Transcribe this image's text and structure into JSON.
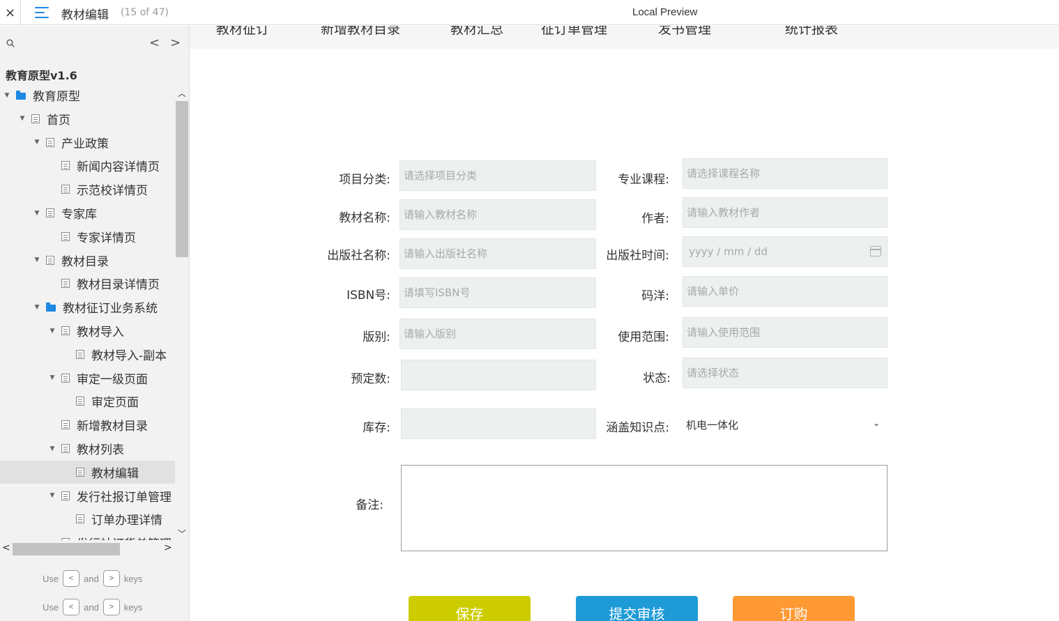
{
  "topbar": {
    "close_label": "×",
    "doc_title": "教材编辑",
    "page_count": "(15 of 47)",
    "preview_title": "Local Preview"
  },
  "sidebar": {
    "prev_label": "<",
    "next_label": ">",
    "project_title": "教育原型v1.6",
    "tree": [
      {
        "label": "教育原型",
        "level": 0,
        "icon": "folder-icon",
        "expanded": true
      },
      {
        "label": "首页",
        "level": 1,
        "icon": "page-icon",
        "expanded": true
      },
      {
        "label": "产业政策",
        "level": 2,
        "icon": "page-icon",
        "expanded": true
      },
      {
        "label": "新闻内容详情页",
        "level": 3,
        "icon": "page-icon",
        "expanded": false
      },
      {
        "label": "示范校详情页",
        "level": 3,
        "icon": "page-icon",
        "expanded": false
      },
      {
        "label": "专家库",
        "level": 2,
        "icon": "page-icon",
        "expanded": true
      },
      {
        "label": "专家详情页",
        "level": 3,
        "icon": "page-icon",
        "expanded": false
      },
      {
        "label": "教材目录",
        "level": 2,
        "icon": "page-icon",
        "expanded": true
      },
      {
        "label": "教材目录详情页",
        "level": 3,
        "icon": "page-icon",
        "expanded": false
      },
      {
        "label": "教材征订业务系统",
        "level": 2,
        "icon": "folder-icon",
        "expanded": true
      },
      {
        "label": "教材导入",
        "level": 3,
        "icon": "page-icon",
        "expanded": true
      },
      {
        "label": "教材导入-副本",
        "level": 4,
        "icon": "page-icon",
        "expanded": false
      },
      {
        "label": "审定一级页面",
        "level": 3,
        "icon": "page-icon",
        "expanded": true
      },
      {
        "label": "审定页面",
        "level": 4,
        "icon": "page-icon",
        "expanded": false
      },
      {
        "label": "新增教材目录",
        "level": 3,
        "icon": "page-icon",
        "expanded": false
      },
      {
        "label": "教材列表",
        "level": 3,
        "icon": "page-icon",
        "expanded": true
      },
      {
        "label": "教材编辑",
        "level": 4,
        "icon": "page-icon",
        "expanded": false,
        "selected": true
      },
      {
        "label": "发行社报订单管理",
        "level": 3,
        "icon": "page-icon",
        "expanded": true
      },
      {
        "label": "订单办理详情",
        "level": 4,
        "icon": "page-icon",
        "expanded": false
      },
      {
        "label": "发行社订货单管理",
        "level": 3,
        "icon": "page-icon",
        "expanded": false
      }
    ],
    "hints": [
      {
        "use": "Use",
        "key1": "<",
        "and": "and",
        "key2": ">",
        "keys": "keys"
      },
      {
        "use": "Use",
        "key1": "<",
        "and": "and",
        "key2": ">",
        "keys": "keys"
      }
    ]
  },
  "main": {
    "topnav": [
      "教材征订",
      "新增教材目录",
      "教材汇总",
      "征订单管理",
      "发书管理",
      "统计报表"
    ],
    "form": {
      "category_label": "项目分类:",
      "category_placeholder": "请选择项目分类",
      "course_label": "专业课程:",
      "course_placeholder": "请选择课程名称",
      "name_label": "教材名称:",
      "name_placeholder": "请输入教材名称",
      "author_label": "作者:",
      "author_placeholder": "请输入教材作者",
      "publisher_label": "出版社名称:",
      "publisher_placeholder": "请输入出版社名称",
      "pubdate_label": "出版社时间:",
      "pubdate_placeholder": "yyyy / mm / dd",
      "isbn_label": "ISBN号:",
      "isbn_placeholder": "请填写ISBN号",
      "price_label": "码洋:",
      "price_placeholder": "请输入单价",
      "edition_label": "版别:",
      "edition_placeholder": "请输入版别",
      "scope_label": "使用范围:",
      "scope_placeholder": "请输入使用范围",
      "preorder_label": "预定数:",
      "preorder_value": "",
      "status_label": "状态:",
      "status_placeholder": "请选择状态",
      "stock_label": "库存:",
      "stock_value": "",
      "knowledge_label": "涵盖知识点:",
      "knowledge_value": "机电一体化",
      "remark_label": "备注:",
      "remark_value": ""
    },
    "buttons": {
      "save": "保存",
      "submit": "提交审核",
      "order": "订购"
    },
    "colors": {
      "save": "#cccc00",
      "submit": "#1e9bd7",
      "order": "#ff9933",
      "accent": "#1e88e5"
    }
  }
}
